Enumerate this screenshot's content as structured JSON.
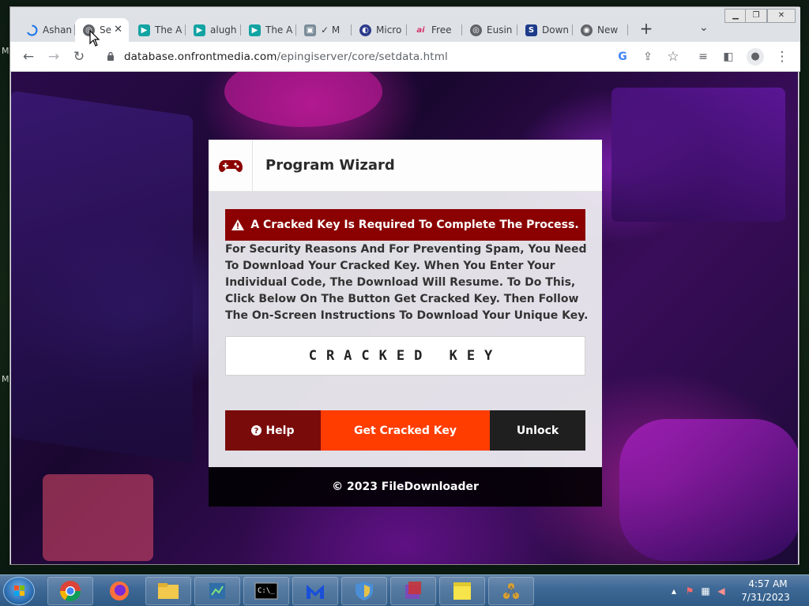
{
  "desktop": {
    "edge_letters": [
      "M",
      "M"
    ]
  },
  "browser": {
    "tabs": [
      {
        "label": "Ashan",
        "icon": "loading-spinner-icon",
        "color": "#1a73e8"
      },
      {
        "label": "Se",
        "icon": "globe-icon",
        "color": "#5f6368",
        "active": true
      },
      {
        "label": "The A",
        "icon": "play-icon",
        "color": "#13a3a3"
      },
      {
        "label": "alugh",
        "icon": "play-icon",
        "color": "#13a3a3"
      },
      {
        "label": "The A",
        "icon": "play-icon",
        "color": "#13a3a3"
      },
      {
        "label": "✓ M",
        "icon": "image-icon",
        "color": "#7a8c99"
      },
      {
        "label": "Micro",
        "icon": "shield-icon",
        "color": "#2b3a8a"
      },
      {
        "label": "Free",
        "icon": "ai-icon",
        "color": "#d6336c"
      },
      {
        "label": "Eusin",
        "icon": "globe-icon",
        "color": "#5f6368"
      },
      {
        "label": "Down",
        "icon": "download-logo-icon",
        "color": "#1d3b8a"
      },
      {
        "label": "New",
        "icon": "chrome-icon",
        "color": "#5f6368"
      }
    ],
    "new_tab_label": "+",
    "url_host": "database.onfrontmedia.com",
    "url_path": "/epingiserver/core/setdata.html"
  },
  "page": {
    "title": "Program Wizard",
    "header_icon": "gamepad-icon",
    "alert_icon": "warning-icon",
    "alert_text": "A Cracked Key Is Required To Complete The Process.",
    "body_text": "For Security Reasons And For Preventing Spam, You Need To Download Your Cracked Key. When You Enter Your Individual Code, The Download Will Resume. To Do This, Click Below On The Button Get Cracked Key. Then Follow The On-Screen Instructions To Download Your Unique Key.",
    "key_field_value": "CRACKED KEY",
    "buttons": {
      "help": "Help",
      "get_key": "Get Cracked Key",
      "unlock": "Unlock"
    },
    "footer": "© 2023 FileDownloader",
    "colors": {
      "alert_bg": "#8b0000",
      "help_bg": "#7a0b0b",
      "get_bg": "#ff3d00",
      "unlock_bg": "#1f1f1f"
    }
  },
  "taskbar": {
    "items": [
      {
        "name": "chrome-taskbar-icon"
      },
      {
        "name": "firefox-taskbar-icon"
      },
      {
        "name": "file-explorer-taskbar-icon"
      },
      {
        "name": "task-manager-taskbar-icon"
      },
      {
        "name": "command-prompt-taskbar-icon"
      },
      {
        "name": "malwarebytes-taskbar-icon"
      },
      {
        "name": "security-shield-taskbar-icon"
      },
      {
        "name": "installer-taskbar-icon"
      },
      {
        "name": "sticky-notes-taskbar-icon"
      },
      {
        "name": "network-tool-taskbar-icon"
      }
    ],
    "clock_time": "4:57 AM",
    "clock_date": "7/31/2023"
  }
}
